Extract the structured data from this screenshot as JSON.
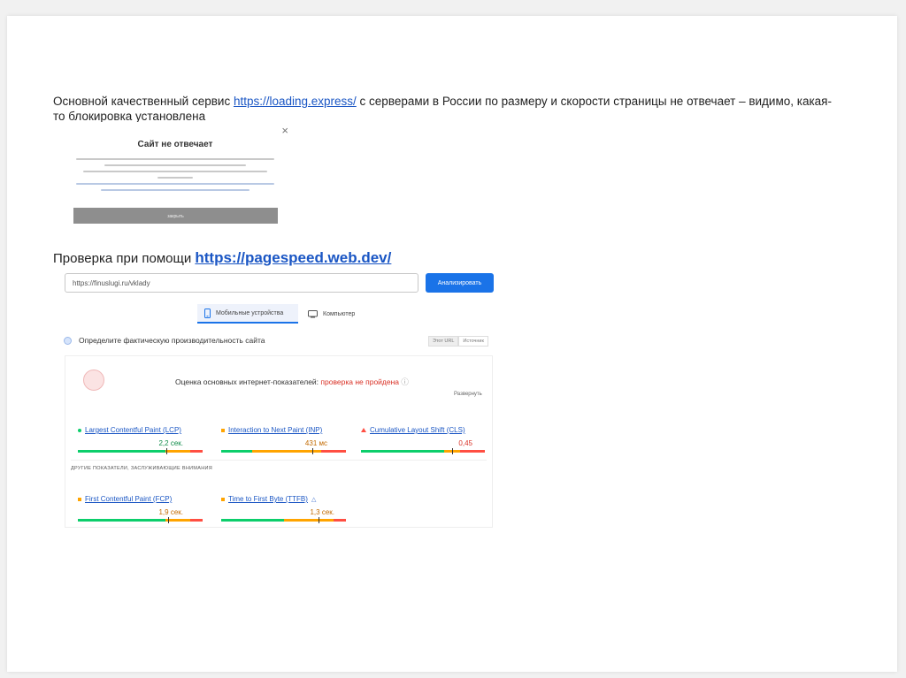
{
  "intro": {
    "text_before": "Основной качественный сервис ",
    "link": "https://loading.express/",
    "text_after": " с серверами в России по размеру и скорости страницы не отвечает – видимо, какая-то блокировка установлена"
  },
  "dialog": {
    "title": "Сайт не отвечает",
    "close_glyph": "×",
    "button_label": "закрыть"
  },
  "pagespeed": {
    "heading_text": "Проверка при помощи ",
    "heading_link": "https://pagespeed.web.dev/",
    "url_value": "https://finuslugi.ru/vklady",
    "analyze_label": "Анализировать",
    "tab_mobile": "Мобильные устройства",
    "tab_desktop": "Компьютер",
    "field_data_label": "Определите фактическую производительность сайта",
    "mini_tab_1": "Этот URL",
    "mini_tab_2": "Источник",
    "cwv_text": "Оценка основных интернет-показателей: ",
    "cwv_status": "проверка не пройдена",
    "expand_label": "Развернуть",
    "other_metrics_label": "ДРУГИЕ ПОКАЗАТЕЛИ, ЗАСЛУЖИВАЮЩИЕ ВНИМАНИЯ",
    "metrics": [
      {
        "label": "Largest Contentful Paint (LCP)",
        "value": "2,2 сек.",
        "rating": "good",
        "marker": 0.71,
        "dist": [
          0.7,
          0.2,
          0.1
        ]
      },
      {
        "label": "Interaction to Next Paint (INP)",
        "value": "431 мс",
        "rating": "needs-improvement",
        "marker": 0.73,
        "dist": [
          0.25,
          0.55,
          0.2
        ]
      },
      {
        "label": "Cumulative Layout Shift (CLS)",
        "value": "0,45",
        "rating": "poor",
        "marker": 0.73,
        "dist": [
          0.67,
          0.13,
          0.2
        ]
      },
      {
        "label": "First Contentful Paint (FCP)",
        "value": "1,9 сек.",
        "rating": "needs-improvement",
        "marker": 0.72,
        "dist": [
          0.7,
          0.2,
          0.1
        ]
      },
      {
        "label": "Time to First Byte (TTFB)",
        "value": "1,3 сек.",
        "rating": "needs-improvement",
        "marker": 0.78,
        "dist": [
          0.5,
          0.4,
          0.1
        ]
      }
    ]
  }
}
